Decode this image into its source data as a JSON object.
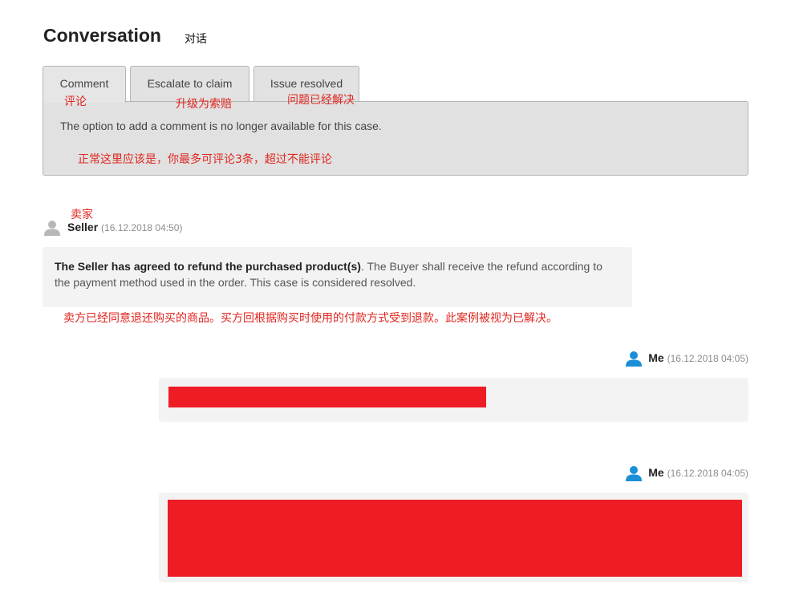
{
  "header": {
    "title": "Conversation",
    "title_cn": "对话"
  },
  "tabs": [
    {
      "label": "Comment",
      "cn": "评论",
      "active": true
    },
    {
      "label": "Escalate to claim",
      "cn": "升级为索赔",
      "active": false
    },
    {
      "label": "Issue resolved",
      "cn": "问题已经解决",
      "active": false
    }
  ],
  "panel": {
    "text": "The option to add a comment is no longer available for this case.",
    "note_cn": "正常这里应该是，你最多可评论3条，超过不能评论"
  },
  "messages": [
    {
      "author_cn": "卖家",
      "author": "Seller",
      "timestamp": "(16.12.2018 04:50)",
      "bold": "The Seller has agreed to refund the purchased product(s)",
      "rest": ". The Buyer shall receive the refund according to the payment method used in the order. This case is considered resolved.",
      "note_cn": "卖方已经同意退还购买的商品。买方回根据购买时使用的付款方式受到退款。此案例被视为已解决。"
    },
    {
      "author": "Me",
      "timestamp": "(16.12.2018 04:05)"
    },
    {
      "author": "Me",
      "timestamp": "(16.12.2018 04:05)"
    }
  ],
  "colors": {
    "annotation": "#e0261f",
    "redaction": "#ee1c25",
    "my_avatar": "#1a8fd8",
    "seller_avatar": "#b7b7b7"
  },
  "icons": {
    "seller_avatar": "user-icon",
    "me_avatar": "user-icon"
  }
}
